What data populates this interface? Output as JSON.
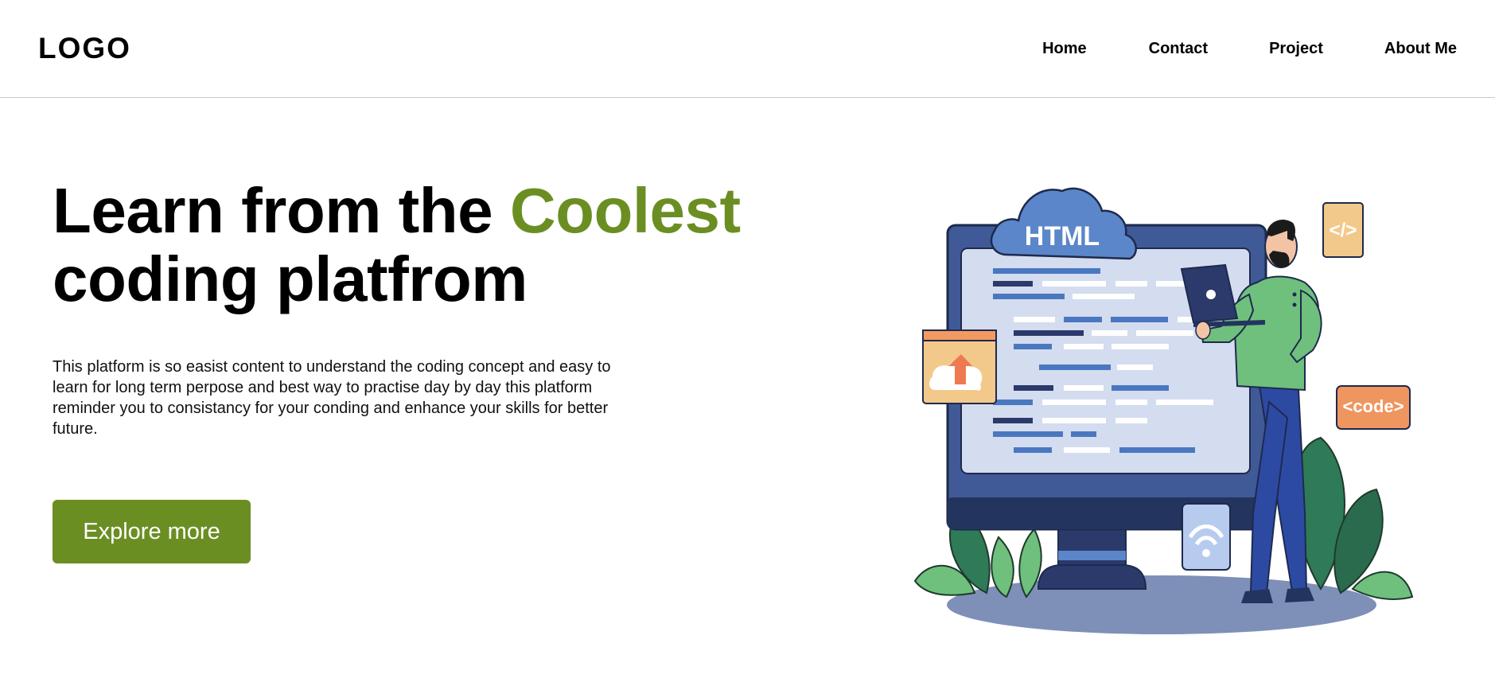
{
  "header": {
    "logo": "LOGO",
    "nav": [
      {
        "label": "Home"
      },
      {
        "label": "Contact"
      },
      {
        "label": "Project"
      },
      {
        "label": "About Me"
      }
    ]
  },
  "hero": {
    "title_part1": "Learn from the ",
    "title_accent": "Coolest",
    "title_part2": "coding platfrom",
    "description": "This platform is so easist content to understand the coding concept and easy to learn for long term perpose and best way to practise day by day this platform reminder you to consistancy for your conding and enhance your skills for better future.",
    "button_label": "Explore more"
  },
  "illustration": {
    "cloud_text": "HTML",
    "tag_right_top": "</>",
    "tag_right": "<code>"
  },
  "colors": {
    "accent": "#6b8e23",
    "monitor": "#3f5a97",
    "screen": "#d4dcef",
    "shirt": "#6fc07d",
    "pants": "#2d4aa3",
    "card_orange": "#f3c98b",
    "code_badge": "#ef9560"
  }
}
